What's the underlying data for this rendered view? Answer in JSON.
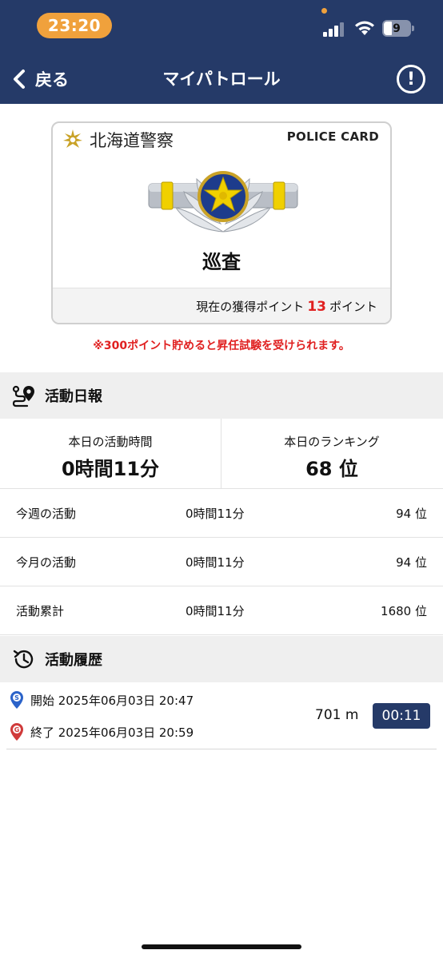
{
  "status_bar": {
    "time": "23:20",
    "battery": "9",
    "colors": {
      "bar": "#253a68",
      "time_pill": "#f0a13c"
    }
  },
  "nav": {
    "back_label": "戻る",
    "title": "マイパトロール",
    "info_icon": "exclamation-circle-icon"
  },
  "card": {
    "org": "北海道警察",
    "label": "POLICE CARD",
    "rank": "巡査",
    "points_prefix": "現在の獲得ポイント",
    "points": "13",
    "points_suffix": "ポイント"
  },
  "notice": "※300ポイント貯めると昇任試験を受けられます。",
  "daily_report": {
    "title": "活動日報",
    "today_time_label": "本日の活動時間",
    "today_time": "0時間11分",
    "today_rank_label": "本日のランキング",
    "today_rank": "68 位",
    "rows": [
      {
        "label": "今週の活動",
        "duration": "0時間11分",
        "rank": "94 位"
      },
      {
        "label": "今月の活動",
        "duration": "0時間11分",
        "rank": "94 位"
      },
      {
        "label": "活動累計",
        "duration": "0時間11分",
        "rank": "1680 位"
      }
    ]
  },
  "history": {
    "title": "活動履歴",
    "items": [
      {
        "start": "開始 2025年06月03日 20:47",
        "end": "終了 2025年06月03日 20:59",
        "distance": "701 m",
        "duration": "00:11"
      }
    ]
  },
  "accent_colors": {
    "navy": "#253a68",
    "red": "#e02020",
    "gold": "#f0c419"
  }
}
